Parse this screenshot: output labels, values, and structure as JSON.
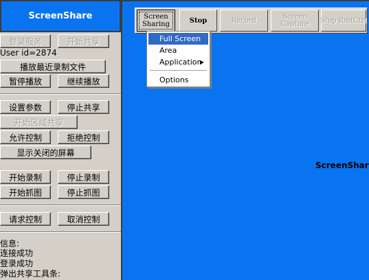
{
  "app": {
    "title": "ScreenShare"
  },
  "left_panel": {
    "buttons": {
      "login_service": "登录服务",
      "start_sharing": "开始共享",
      "play_recent_recording": "播放最近录制文件",
      "pause_playback": "暂停播放",
      "resume_playback": "继续播放",
      "set_params": "设置参数",
      "stop_sharing": "停止共享",
      "start_region_sharing": "开始区域共享",
      "allow_control": "允许控制",
      "reject_control": "拒绝控制",
      "show_closed_screen": "显示关闭的屏幕",
      "start_recording": "开始录制",
      "stop_recording": "停止录制",
      "start_capture": "开始抓图",
      "stop_capture": "停止抓图",
      "request_control": "请求控制",
      "cancel_control": "取消控制"
    },
    "user_id": "User id=2874",
    "info": {
      "header": "信息:",
      "lines": [
        "连接成功",
        "登录成功",
        "弹出共享工具条:"
      ]
    }
  },
  "viewer": {
    "watermark": "ScreenShare",
    "toolbar": {
      "screen_sharing": [
        "Screen",
        "Sharing"
      ],
      "stop": "Stop",
      "record": "Record",
      "screen_capture": [
        "Screen",
        "Capture"
      ],
      "stop_rmtctrl": "Stop RmtCtrl"
    },
    "menu": {
      "items": [
        "Full Screen",
        "Area",
        "Application",
        "Options"
      ],
      "selected": "Full Screen",
      "submenu_arrow": "▶"
    }
  },
  "colors": {
    "accent": "#0a74f0",
    "panel": "#d4d0c8",
    "menu_highlight": "#316ac5"
  }
}
